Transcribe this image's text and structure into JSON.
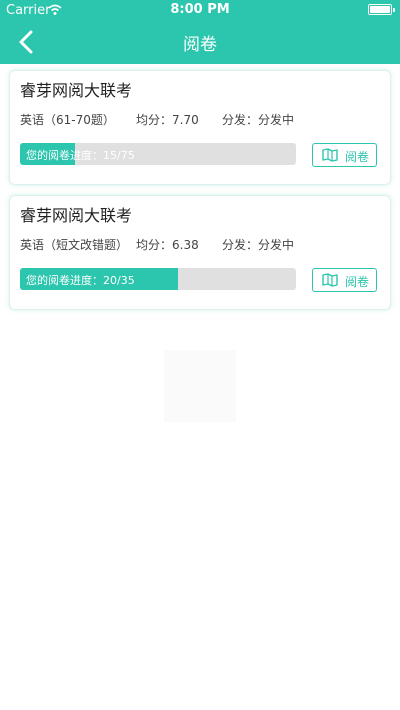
{
  "status_bar": {
    "carrier": "Carrier",
    "time": "8:00 PM"
  },
  "nav": {
    "title": "阅卷"
  },
  "cards": [
    {
      "title": "睿芽网阅大联考",
      "subject": "英语（61-70题）",
      "average": "均分：7.70",
      "status": "分发：分发中",
      "progress_label": "您的阅卷进度：15/75",
      "progress_fraction": 0.2,
      "button_label": "阅卷"
    },
    {
      "title": "睿芽网阅大联考",
      "subject": "英语（短文改错题）",
      "average": "均分：6.38",
      "status": "分发：分发中",
      "progress_label": "您的阅卷进度：20/35",
      "progress_fraction": 0.571,
      "button_label": "阅卷"
    }
  ],
  "colors": {
    "accent": "#2bc6ad",
    "progress_track": "#e0e0e0"
  },
  "icons": {
    "back": "chevron-left-icon",
    "wifi": "wifi-icon",
    "battery": "battery-icon",
    "read": "book-icon"
  }
}
